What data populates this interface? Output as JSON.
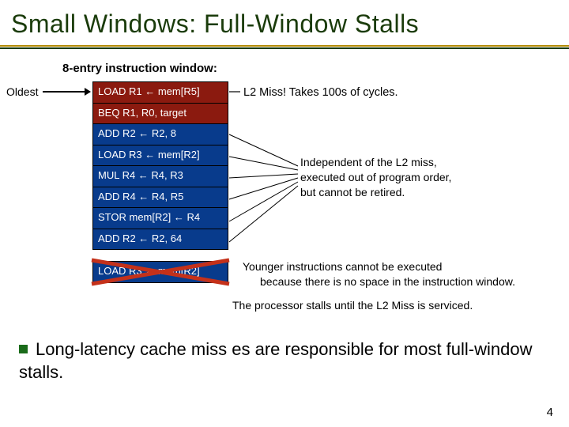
{
  "title": "Small Windows: Full-Window Stalls",
  "subhead": "8-entry instruction window:",
  "oldest_label": "Oldest",
  "window_rows": [
    {
      "text": "LOAD R1 ← mem[R5]",
      "kind": "stall"
    },
    {
      "text": "BEQ R1, R0, target",
      "kind": "stall"
    },
    {
      "text": "ADD R2 ← R2, 8",
      "kind": "done"
    },
    {
      "text": "LOAD R3 ← mem[R2]",
      "kind": "done"
    },
    {
      "text": "MUL R4 ← R4, R3",
      "kind": "done"
    },
    {
      "text": "ADD R4 ← R4, R5",
      "kind": "done"
    },
    {
      "text": "STOR mem[R2] ← R4",
      "kind": "done"
    },
    {
      "text": "ADD R2 ← R2, 64",
      "kind": "done"
    }
  ],
  "extra_row": "LOAD R3 ← mem[R2]",
  "l2miss": "L2 Miss! Takes 100s of cycles.",
  "independent": {
    "l1": "Independent of the L2 miss,",
    "l2": "executed out of program order,",
    "l3": "but cannot be retired."
  },
  "younger": {
    "l1": "Younger instructions cannot be executed",
    "l2": "because there is no space in the instruction window."
  },
  "proc_stall": "The processor stalls until the L2 Miss is serviced.",
  "bullet": "Long-latency cache miss es are responsible for most        full-window stalls.",
  "page_number": "4"
}
